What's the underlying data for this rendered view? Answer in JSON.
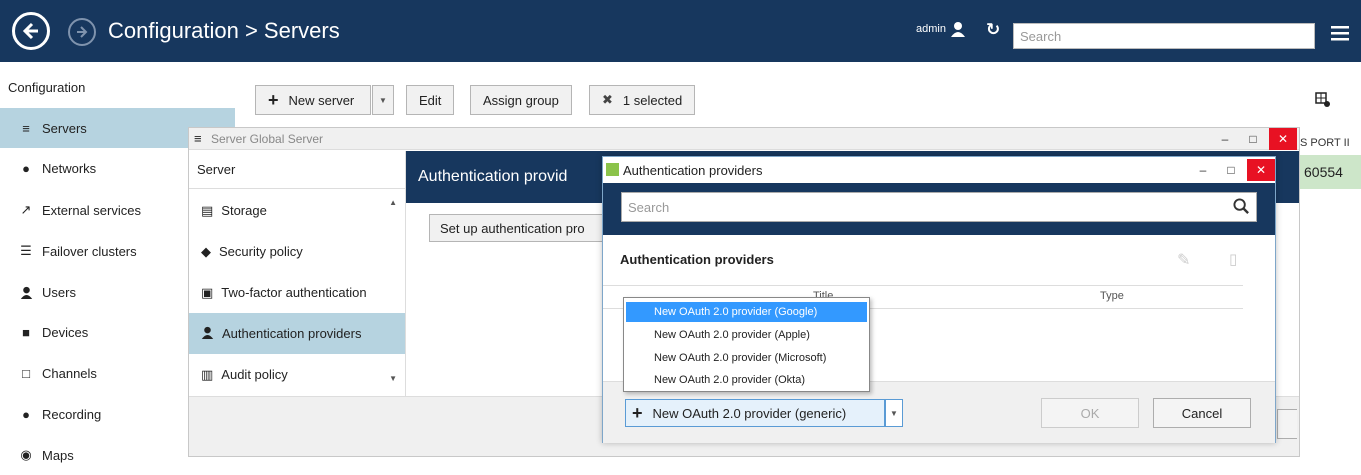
{
  "header": {
    "title": "Configuration > Servers",
    "user": "admin",
    "search_placeholder": "Search",
    "colors": {
      "bar": "#17375e",
      "active": "#b6d3e0",
      "highlight": "#3399ff"
    }
  },
  "sidebar": {
    "title": "Configuration",
    "items": [
      {
        "label": "Servers",
        "icon": "database-icon"
      },
      {
        "label": "Networks",
        "icon": "globe-icon"
      },
      {
        "label": "External services",
        "icon": "external-link-icon"
      },
      {
        "label": "Failover clusters",
        "icon": "list-icon"
      },
      {
        "label": "Users",
        "icon": "user-icon"
      },
      {
        "label": "Devices",
        "icon": "camera-icon"
      },
      {
        "label": "Channels",
        "icon": "monitor-icon"
      },
      {
        "label": "Recording",
        "icon": "record-icon"
      },
      {
        "label": "Maps",
        "icon": "map-pin-icon"
      }
    ]
  },
  "toolbar": {
    "new_server": "New server",
    "edit": "Edit",
    "assign_group": "Assign group",
    "selected": "1 selected"
  },
  "table_peek": {
    "header": "S PORT  II",
    "value": "60554"
  },
  "server_window": {
    "title": "Server Global Server",
    "left_header": "Server",
    "items": [
      {
        "label": "Storage",
        "icon": "drive-icon"
      },
      {
        "label": "Security policy",
        "icon": "shield-icon"
      },
      {
        "label": "Two-factor authentication",
        "icon": "lock-icon"
      },
      {
        "label": "Authentication providers",
        "icon": "user-icon"
      },
      {
        "label": "Audit policy",
        "icon": "book-icon"
      }
    ],
    "right_header": "Authentication provid",
    "setup_button": "Set up authentication pro"
  },
  "auth_dialog": {
    "title": "Authentication providers",
    "search_placeholder": "Search",
    "subtitle": "Authentication providers",
    "columns": [
      "Title",
      "Type"
    ],
    "menu_items": [
      "New OAuth 2.0 provider (Google)",
      "New OAuth 2.0 provider (Apple)",
      "New OAuth 2.0 provider (Microsoft)",
      "New OAuth 2.0 provider (Okta)"
    ],
    "new_button": "New OAuth 2.0 provider (generic)",
    "ok": "OK",
    "cancel": "Cancel"
  }
}
